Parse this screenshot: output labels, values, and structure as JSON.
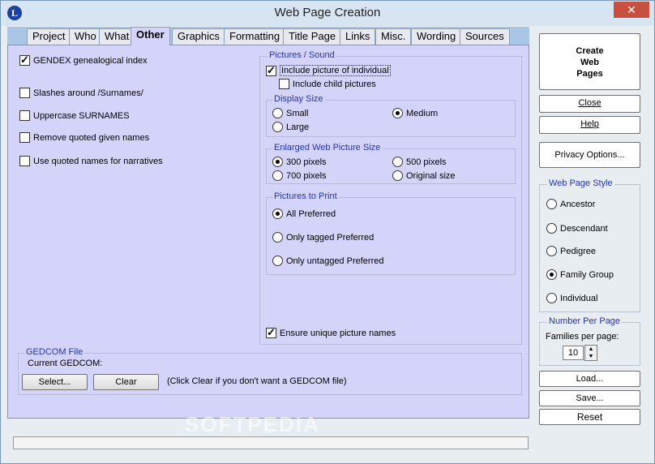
{
  "window": {
    "title": "Web Page Creation",
    "app_icon_glyph": "L",
    "close_glyph": "✕"
  },
  "tabs": [
    "Project",
    "Who",
    "What",
    "Other",
    "Graphics",
    "Formatting",
    "Title Page",
    "Links",
    "Misc.",
    "Wording",
    "Sources"
  ],
  "active_tab": "Other",
  "left_options": [
    {
      "label": "GENDEX genealogical index",
      "checked": true
    },
    {
      "label": "Slashes around /Surnames/",
      "checked": false
    },
    {
      "label": "Uppercase SURNAMES",
      "checked": false
    },
    {
      "label": "Remove quoted given names",
      "checked": false
    },
    {
      "label": "Use quoted names for narratives",
      "checked": false
    }
  ],
  "pictures": {
    "group_title": "Pictures / Sound",
    "include_individual": {
      "label": "Include picture of individual",
      "checked": true
    },
    "include_child": {
      "label": "Include child pictures",
      "checked": false
    },
    "display_size": {
      "title": "Display Size",
      "options": [
        {
          "label": "Small",
          "selected": false
        },
        {
          "label": "Medium",
          "selected": true
        },
        {
          "label": "Large",
          "selected": false
        }
      ]
    },
    "enlarged": {
      "title": "Enlarged Web Picture Size",
      "options": [
        {
          "label": "300 pixels",
          "selected": true
        },
        {
          "label": "500 pixels",
          "selected": false
        },
        {
          "label": "700 pixels",
          "selected": false
        },
        {
          "label": "Original size",
          "selected": false
        }
      ]
    },
    "to_print": {
      "title": "Pictures to Print",
      "options": [
        {
          "label": "All Preferred",
          "selected": true
        },
        {
          "label": "Only tagged Preferred",
          "selected": false
        },
        {
          "label": "Only untagged Preferred",
          "selected": false
        }
      ]
    },
    "unique_names": {
      "label": "Ensure unique picture names",
      "checked": true
    }
  },
  "gedcom": {
    "title": "GEDCOM File",
    "current_label": "Current GEDCOM:",
    "select_label": "Select...",
    "clear_label": "Clear",
    "hint": "(Click Clear if you don't want a GEDCOM file)"
  },
  "watermark": "SOFTPEDIA",
  "side": {
    "create_label": "Create\nWeb\nPages",
    "close_label": "Close",
    "help_label": "Help",
    "privacy_label": "Privacy Options...",
    "style": {
      "title": "Web Page Style",
      "options": [
        {
          "label": "Ancestor",
          "selected": false
        },
        {
          "label": "Descendant",
          "selected": false
        },
        {
          "label": "Pedigree",
          "selected": false
        },
        {
          "label": "Family Group",
          "selected": true
        },
        {
          "label": "Individual",
          "selected": false
        }
      ]
    },
    "number": {
      "title": "Number Per Page",
      "label": "Families per page:",
      "value": "10"
    },
    "load_label": "Load...",
    "save_label": "Save...",
    "reset_label": "Reset"
  },
  "status_text": ""
}
